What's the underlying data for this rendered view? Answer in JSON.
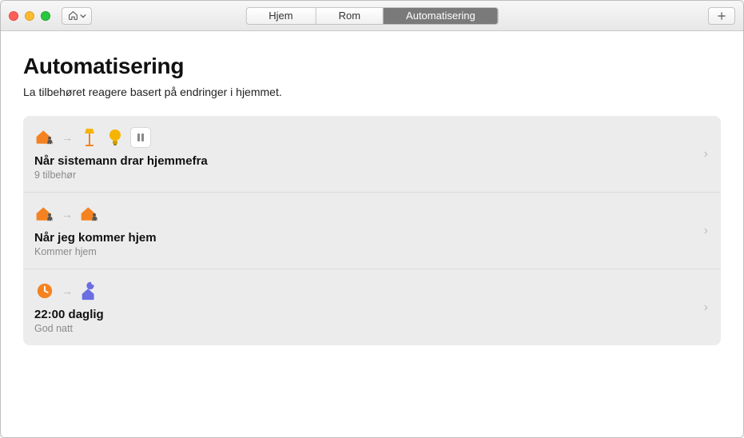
{
  "colors": {
    "orange": "#f58220",
    "gold": "#f5b400",
    "purple": "#6a6ee0",
    "grey": "#b8b8b8"
  },
  "tabs": {
    "home": "Hjem",
    "rooms": "Rom",
    "automation": "Automatisering",
    "active": "automation"
  },
  "header": {
    "title": "Automatisering",
    "subtitle": "La tilbehøret reagere basert på endringer i hjemmet."
  },
  "rows": [
    {
      "title": "Når sistemann drar hjemmefra",
      "subtitle": "9 tilbehør",
      "icons": [
        "house-person-leave",
        "arrow",
        "floor-lamp",
        "bulb",
        "switch-tile"
      ]
    },
    {
      "title": "Når jeg kommer hjem",
      "subtitle": "Kommer hjem",
      "icons": [
        "house-person-arrive",
        "arrow",
        "house-person-arrive"
      ]
    },
    {
      "title": "22:00 daglig",
      "subtitle": "God natt",
      "icons": [
        "clock",
        "arrow",
        "moon-house"
      ]
    }
  ]
}
